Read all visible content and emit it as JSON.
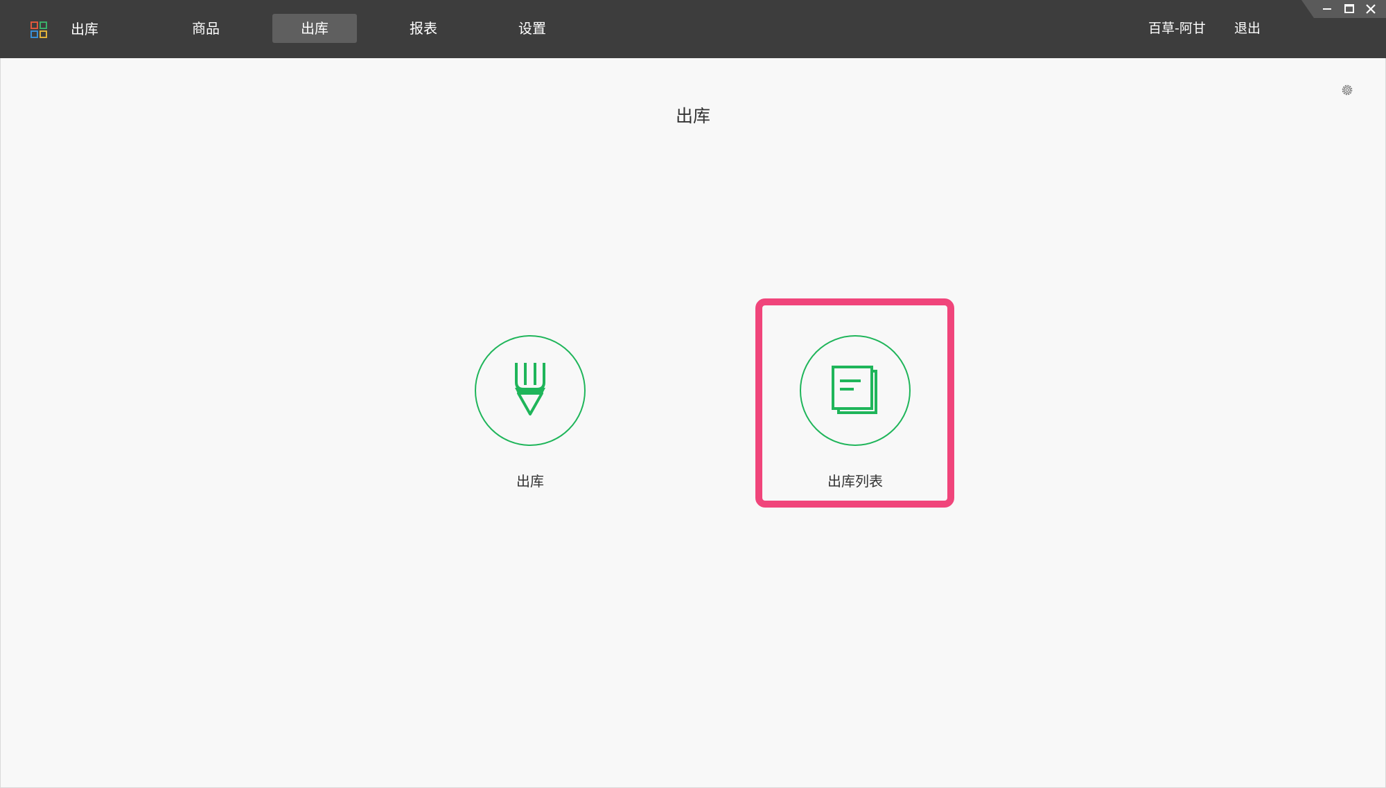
{
  "header": {
    "app_title": "出库",
    "tabs": [
      {
        "label": "商品",
        "active": false
      },
      {
        "label": "出库",
        "active": true
      },
      {
        "label": "报表",
        "active": false
      },
      {
        "label": "设置",
        "active": false
      }
    ],
    "user_name": "百草-阿甘",
    "logout_label": "退出"
  },
  "main": {
    "page_title": "出库",
    "tiles": [
      {
        "label": "出库",
        "icon": "pencil-icon"
      },
      {
        "label": "出库列表",
        "icon": "document-list-icon",
        "highlighted": true
      }
    ]
  },
  "colors": {
    "topbar": "#3d3d3d",
    "active_tab": "#5f5f5f",
    "accent_green": "#1fb55a",
    "highlight": "#f0457b",
    "background": "#f8f8f8"
  }
}
